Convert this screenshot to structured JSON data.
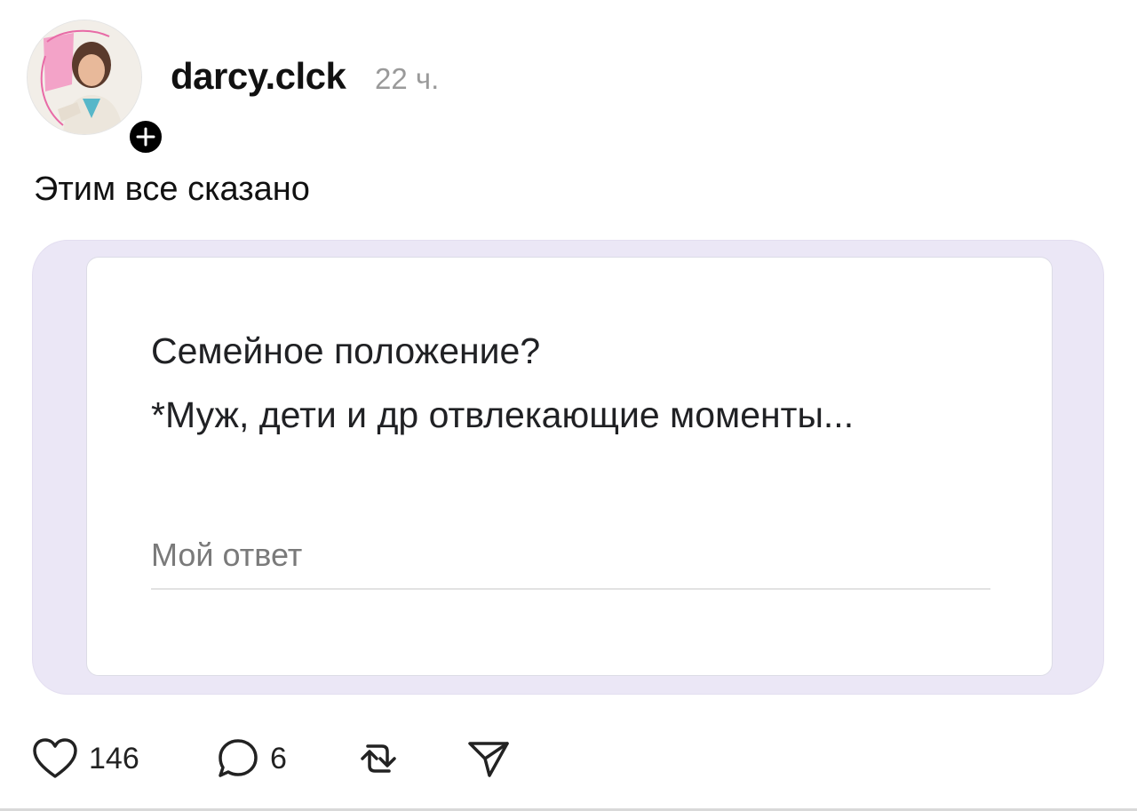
{
  "post": {
    "author": {
      "username": "darcy.clck",
      "avatar_icon": "profile-photo",
      "follow_icon": "plus-icon"
    },
    "timestamp": "22 ч.",
    "caption": "Этим все сказано",
    "media": {
      "frame_color": "#ebe7f6",
      "form": {
        "question": "Семейное положение?",
        "note": "*Муж, дети и др отвлекающие моменты...",
        "answer_placeholder": "Мой ответ"
      }
    },
    "actions": {
      "like_icon": "heart-icon",
      "like_count": "146",
      "comment_icon": "comment-bubble-icon",
      "comment_count": "6",
      "repost_icon": "repost-icon",
      "share_icon": "send-icon"
    }
  }
}
